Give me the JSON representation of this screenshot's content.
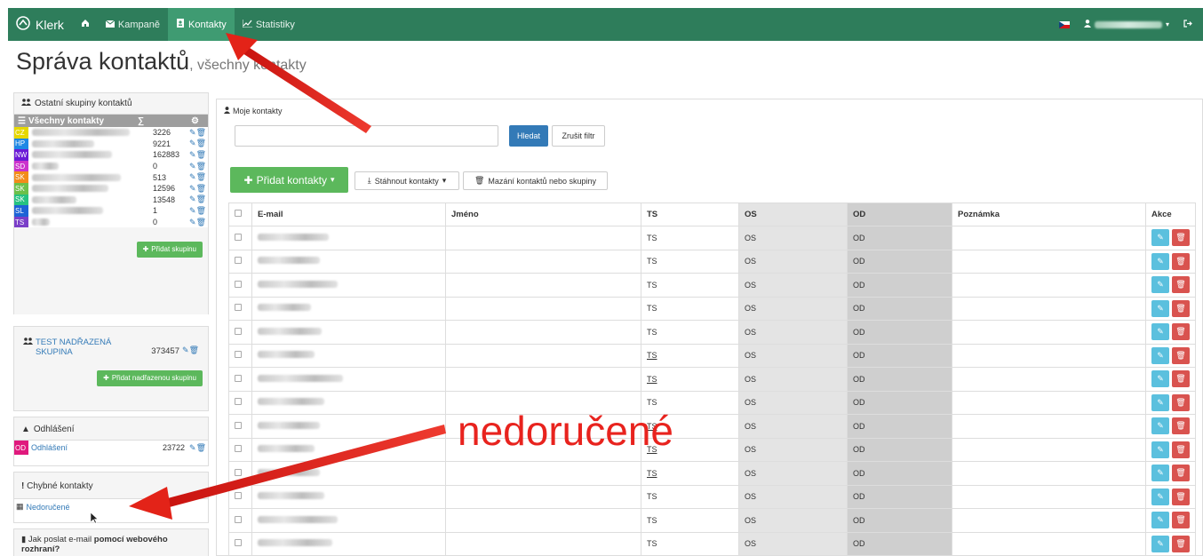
{
  "navbar": {
    "brand": "Klerk",
    "items": [
      {
        "label": "Kampaně",
        "icon": "envelope-icon"
      },
      {
        "label": "Kontakty",
        "icon": "contact-book-icon",
        "active": true
      },
      {
        "label": "Statistiky",
        "icon": "line-chart-icon"
      }
    ],
    "accent": "#2e7d5b"
  },
  "page": {
    "title": "Správa kontaktů",
    "subtitle": ", všechny kontakty"
  },
  "groups_panel": {
    "title": "Ostatní skupiny kontaktů",
    "header": {
      "label": "Všechny kontakty",
      "sum_symbol": "∑"
    },
    "rows": [
      {
        "code": "CZ",
        "color": "#e6d800",
        "count": "3226"
      },
      {
        "code": "HP",
        "color": "#1e88e5",
        "count": "9221"
      },
      {
        "code": "NW",
        "color": "#6a1bd6",
        "count": "162883"
      },
      {
        "code": "SD",
        "color": "#cc33cc",
        "count": "0"
      },
      {
        "code": "SK",
        "color": "#f28c1a",
        "count": "513"
      },
      {
        "code": "SK",
        "color": "#6cc04a",
        "count": "12596"
      },
      {
        "code": "SK",
        "color": "#26c281",
        "count": "13548"
      },
      {
        "code": "SL",
        "color": "#1e63d6",
        "count": "1"
      },
      {
        "code": "TS",
        "color": "#7b3fc8",
        "count": "0"
      }
    ],
    "add_button": "Přidat skupinu"
  },
  "parent_panel": {
    "name": "TEST NADŘAZENÁ SKUPINA",
    "count": "373457",
    "add_button": "Přidat nadřazenou skupinu"
  },
  "unsub_panel": {
    "title": "Odhlášení",
    "code": "OD",
    "color": "#e0197d",
    "label": "Odhlášení",
    "count": "23722"
  },
  "bad_panel": {
    "title": "Chybné kontakty",
    "label": "Nedoručené"
  },
  "help_panel": {
    "text_a": "Jak poslat e-mail",
    "text_b": "pomocí webového",
    "text_c": "rozhraní?"
  },
  "main": {
    "title": "Moje kontakty",
    "search": {
      "value": "",
      "button": "Hledat",
      "clear": "Zrušit filtr"
    },
    "add_contacts": "Přidat kontakty",
    "download": "Stáhnout kontakty",
    "delete": "Mazání kontaktů nebo skupiny",
    "table": {
      "columns": [
        "E-mail",
        "Jméno",
        "TS",
        "OS",
        "OD",
        "Poznámka",
        "Akce"
      ],
      "rows": [
        {
          "ts": "TS",
          "os": "OS",
          "od": "OD",
          "ts_underline": false
        },
        {
          "ts": "TS",
          "os": "OS",
          "od": "OD",
          "ts_underline": false
        },
        {
          "ts": "TS",
          "os": "OS",
          "od": "OD",
          "ts_underline": false
        },
        {
          "ts": "TS",
          "os": "OS",
          "od": "OD",
          "ts_underline": false
        },
        {
          "ts": "TS",
          "os": "OS",
          "od": "OD",
          "ts_underline": false
        },
        {
          "ts": "TS",
          "os": "OS",
          "od": "OD",
          "ts_underline": true
        },
        {
          "ts": "TS",
          "os": "OS",
          "od": "OD",
          "ts_underline": true
        },
        {
          "ts": "TS",
          "os": "OS",
          "od": "OD",
          "ts_underline": false
        },
        {
          "ts": "TS",
          "os": "OS",
          "od": "OD",
          "ts_underline": true
        },
        {
          "ts": "TS",
          "os": "OS",
          "od": "OD",
          "ts_underline": true
        },
        {
          "ts": "TS",
          "os": "OS",
          "od": "OD",
          "ts_underline": true
        },
        {
          "ts": "TS",
          "os": "OS",
          "od": "OD",
          "ts_underline": false
        },
        {
          "ts": "TS",
          "os": "OS",
          "od": "OD",
          "ts_underline": false
        },
        {
          "ts": "TS",
          "os": "OS",
          "od": "OD",
          "ts_underline": false
        },
        {
          "ts": "TS",
          "os": "OS",
          "od": "OD",
          "ts_underline": false
        }
      ]
    }
  },
  "annotation": {
    "text": "nedoručené",
    "color": "#e8231e"
  }
}
